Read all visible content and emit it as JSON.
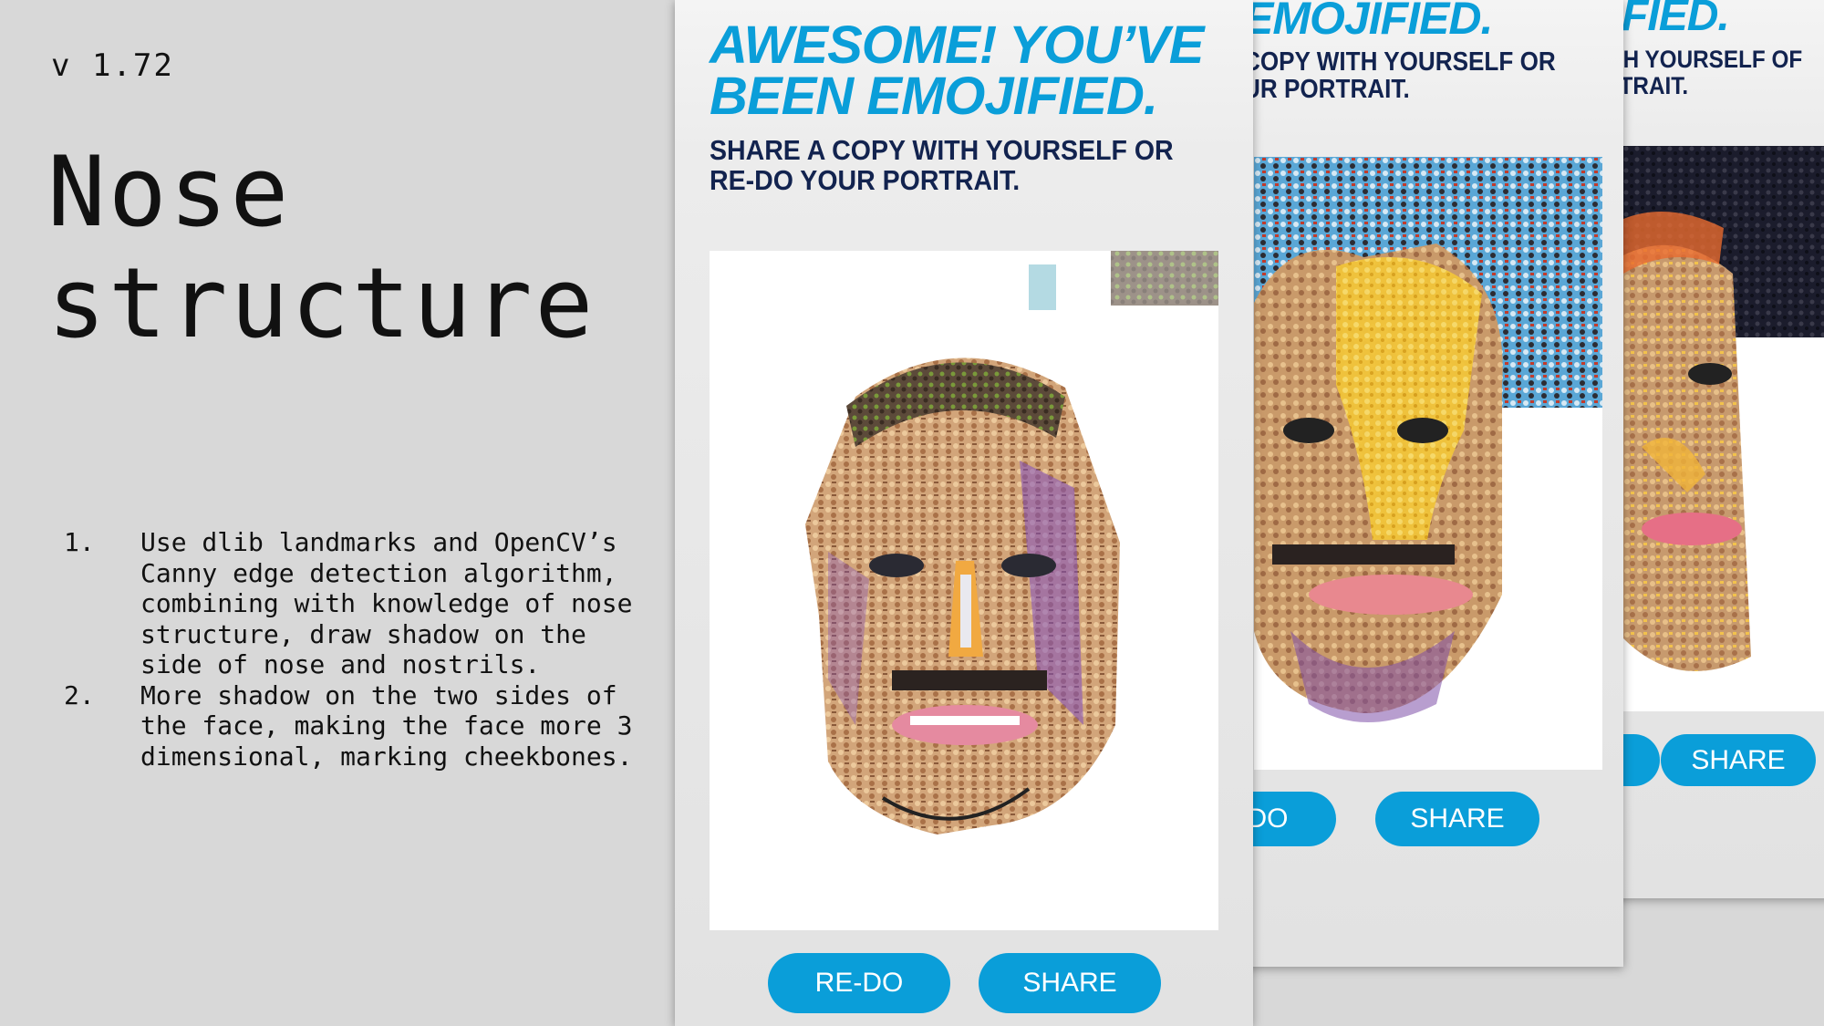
{
  "version": "v 1.72",
  "title": {
    "line1": "Nose",
    "line2": "structure"
  },
  "steps": [
    {
      "number": "1.",
      "text": "Use dlib landmarks and OpenCV’s Canny edge detection algorithm, combining with knowledge of nose structure, draw shadow on the side of nose and nostrils."
    },
    {
      "number": "2.",
      "text": "More shadow on the two sides of the face, making the face more 3 dimensional, marking cheekbones."
    }
  ],
  "panels": [
    {
      "headline_line1": "AWESOME! YOU’VE",
      "headline_line2": "BEEN EMOJIFIED.",
      "subline_line1": "SHARE A COPY WITH YOURSELF OR",
      "subline_line2": "RE-DO YOUR PORTRAIT.",
      "redo_label": "RE-DO",
      "share_label": "SHARE"
    },
    {
      "headline": "EMOJIFIED.",
      "subline_line1": "COPY WITH YOURSELF OR",
      "subline_line2": "UR PORTRAIT.",
      "redo_label": "E-DO",
      "share_label": "SHARE"
    },
    {
      "headline": "JIFIED.",
      "subline_line1": "ITH YOURSELF OF",
      "subline_line2": "RTRAIT.",
      "redo_label": "",
      "share_label": "SHARE"
    }
  ],
  "colors": {
    "background": "#d8d8d8",
    "headline_blue": "#0a9ed9",
    "subline_navy": "#12234f",
    "button_blue": "#0a9ed9"
  }
}
